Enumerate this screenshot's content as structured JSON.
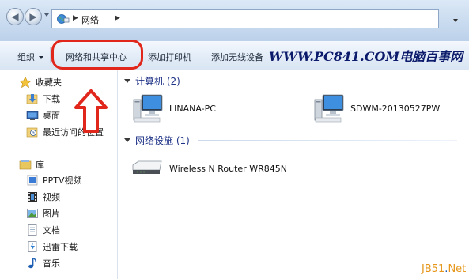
{
  "address_bar": {
    "path": [
      "网络"
    ]
  },
  "toolbar": {
    "organize_label": "组织",
    "network_sharing_center_label": "网络和共享中心",
    "add_printer_label": "添加打印机",
    "add_wireless_device_label": "添加无线设备"
  },
  "watermark": "WWW.PC841.COM电脑百事网",
  "nav": {
    "favorites": {
      "label": "收藏夹",
      "items": [
        {
          "label": "下载",
          "icon": "downloads-folder-icon"
        },
        {
          "label": "桌面",
          "icon": "desktop-icon"
        },
        {
          "label": "最近访问的位置",
          "icon": "recent-places-icon"
        }
      ]
    },
    "libraries": {
      "label": "库",
      "items": [
        {
          "label": "PPTV视频",
          "icon": "pptv-video-icon"
        },
        {
          "label": "视频",
          "icon": "video-library-icon"
        },
        {
          "label": "图片",
          "icon": "pictures-library-icon"
        },
        {
          "label": "文档",
          "icon": "documents-library-icon"
        },
        {
          "label": "迅雷下载",
          "icon": "thunder-download-icon"
        },
        {
          "label": "音乐",
          "icon": "music-library-icon"
        }
      ]
    }
  },
  "groups": {
    "computers": {
      "header": "计算机 (2)",
      "items": [
        {
          "label": "LINANA-PC",
          "icon": "computer-icon"
        },
        {
          "label": "SDWM-20130527PW",
          "icon": "computer-icon"
        }
      ]
    },
    "network_infrastructure": {
      "header": "网络设施 (1)",
      "items": [
        {
          "label": "Wireless N Router WR845N",
          "icon": "router-icon"
        }
      ]
    }
  },
  "corner_logo": {
    "prefix": "JB51",
    "dot": ".",
    "suffix": "Net"
  },
  "colors": {
    "annotation_red": "#e1261c",
    "group_header_blue": "#1e3287",
    "watermark_navy": "#0b1a6a"
  }
}
